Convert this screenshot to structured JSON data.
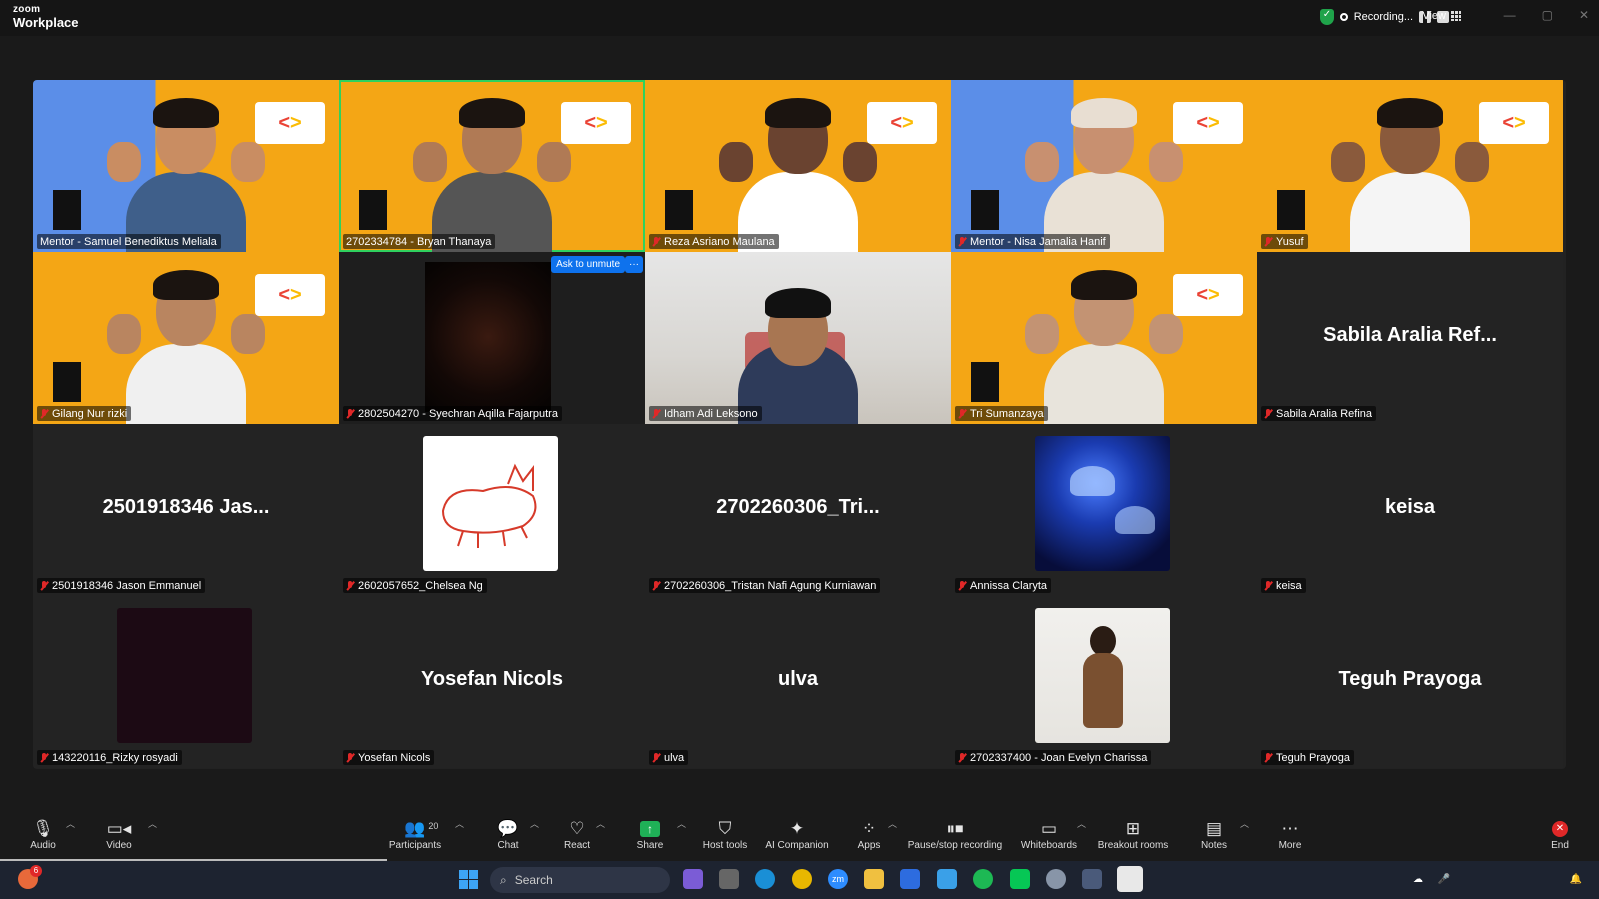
{
  "app": {
    "brand_top": "zoom",
    "brand_bottom": "Workplace"
  },
  "status": {
    "recording_label": "Recording...",
    "view_label": "View"
  },
  "participants": [
    {
      "name": "Mentor - Samuel Benediktus Meliala",
      "muted": false,
      "kind": "video"
    },
    {
      "name": "2702334784 - Bryan Thanaya",
      "muted": false,
      "kind": "video",
      "active": true
    },
    {
      "name": "Reza Asriano Maulana",
      "muted": true,
      "kind": "video"
    },
    {
      "name": "Mentor - Nisa Jamalia Hanif",
      "muted": true,
      "kind": "video"
    },
    {
      "name": "Yusuf",
      "muted": true,
      "kind": "video"
    },
    {
      "name": "Gilang Nur rizki",
      "muted": true,
      "kind": "video"
    },
    {
      "name": "2802504270 - Syechran Aqilla Fajarputra",
      "muted": true,
      "kind": "video-dark",
      "action": "Ask to unmute",
      "more": "···"
    },
    {
      "name": "Idham Adi Leksono",
      "muted": true,
      "kind": "video-room"
    },
    {
      "name": "Tri Sumanzaya",
      "muted": true,
      "kind": "video"
    },
    {
      "name": "Sabila Aralia Refina",
      "muted": true,
      "kind": "text",
      "display": "Sabila Aralia Ref..."
    },
    {
      "name": "2501918346 Jason Emmanuel",
      "muted": true,
      "kind": "text",
      "display": "2501918346  Jas..."
    },
    {
      "name": "2602057652_Chelsea Ng",
      "muted": true,
      "kind": "avatar-drawing"
    },
    {
      "name": "2702260306_Tristan Nafi Agung Kurniawan",
      "muted": true,
      "kind": "text",
      "display": "2702260306_Tri..."
    },
    {
      "name": "Annissa Claryta",
      "muted": true,
      "kind": "avatar-jelly"
    },
    {
      "name": "keisa",
      "muted": true,
      "kind": "text",
      "display": "keisa"
    },
    {
      "name": "143220116_Rizky rosyadi",
      "muted": true,
      "kind": "avatar-dark"
    },
    {
      "name": "Yosefan Nicols",
      "muted": true,
      "kind": "text",
      "display": "Yosefan Nicols"
    },
    {
      "name": "ulva",
      "muted": true,
      "kind": "text",
      "display": "ulva"
    },
    {
      "name": "2702337400 - Joan Evelyn Charissa",
      "muted": true,
      "kind": "avatar-photo"
    },
    {
      "name": "Teguh Prayoga",
      "muted": true,
      "kind": "text",
      "display": "Teguh Prayoga"
    }
  ],
  "toolbar": {
    "audio": "Audio",
    "video": "Video",
    "participants": "Participants",
    "participants_count": "20",
    "chat": "Chat",
    "react": "React",
    "share": "Share",
    "host_tools": "Host tools",
    "ai_companion": "AI Companion",
    "apps": "Apps",
    "pause_recording": "Pause/stop recording",
    "whiteboards": "Whiteboards",
    "breakout": "Breakout rooms",
    "notes": "Notes",
    "more": "More",
    "end": "End"
  },
  "taskbar": {
    "search_placeholder": "Search",
    "notification_count": "6"
  },
  "colors": {
    "active_border": "#2fd15e",
    "mute_red": "#e02828",
    "share_green": "#1fb157",
    "accent_blue": "#0e72ed"
  }
}
